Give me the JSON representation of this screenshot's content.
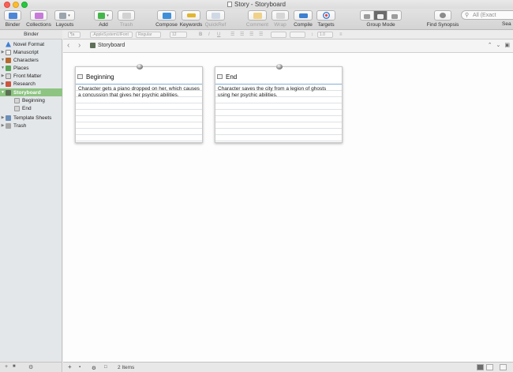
{
  "window": {
    "title": "Story - Storyboard"
  },
  "toolbar": {
    "binder": "Binder",
    "collections": "Collections",
    "layouts": "Layouts",
    "add": "Add",
    "trash": "Trash",
    "compose": "Compose",
    "keywords": "Keywords",
    "quickref": "QuickRef",
    "comment": "Comment",
    "wrap": "Wrap",
    "compile": "Compile",
    "targets": "Targets",
    "group_mode": "Group Mode",
    "find_synopsis": "Find Synopsis",
    "search_label": "Sea",
    "search_placeholder": "All (Exact"
  },
  "format_bar": {
    "style": "¶a",
    "font": ".AppleSystemUIFont",
    "weight": "Regular",
    "size": "12",
    "bold": "B",
    "italic": "I",
    "underline": "U",
    "line_spacing": "1.0"
  },
  "binder": {
    "header": "Binder",
    "items": [
      {
        "label": "Novel Format",
        "icon": "warning-icon",
        "depth": 0,
        "expander": ""
      },
      {
        "label": "Manuscript",
        "icon": "manuscript-icon",
        "depth": 0,
        "expander": "▶"
      },
      {
        "label": "Characters",
        "icon": "characters-icon",
        "depth": 0,
        "expander": "▼"
      },
      {
        "label": "Places",
        "icon": "places-icon",
        "depth": 0,
        "expander": "▼"
      },
      {
        "label": "Front Matter",
        "icon": "folder-icon",
        "depth": 0,
        "expander": "▶"
      },
      {
        "label": "Research",
        "icon": "research-icon",
        "depth": 0,
        "expander": "▶"
      },
      {
        "label": "Storyboard",
        "icon": "corkboard-icon",
        "depth": 0,
        "expander": "▼",
        "selected": true
      },
      {
        "label": "Beginning",
        "icon": "card-icon",
        "depth": 1,
        "expander": ""
      },
      {
        "label": "End",
        "icon": "card-icon",
        "depth": 1,
        "expander": ""
      },
      {
        "label": "Template Sheets",
        "icon": "template-icon",
        "depth": 0,
        "expander": "▶"
      },
      {
        "label": "Trash",
        "icon": "trash-icon",
        "depth": 0,
        "expander": "▶"
      }
    ],
    "footer": {
      "add": "+",
      "settings": "⚙"
    }
  },
  "editor": {
    "breadcrumb": "Storyboard",
    "back": "‹",
    "forward": "›",
    "cards": [
      {
        "title": "Beginning",
        "synopsis": "Character gets a piano dropped on her, which causes a concussion that gives her psychic abilities."
      },
      {
        "title": "End",
        "synopsis": "Character saves the city from a legion of ghosts using her psychic abilities."
      }
    ],
    "footer": {
      "add": "+",
      "item_count": "2 Items"
    }
  },
  "colors": {
    "selection": "#8dc482",
    "traffic_close": "#fc5f57",
    "traffic_min": "#fdbc2e",
    "traffic_max": "#27c840",
    "card_divider": "#7fb0d8"
  }
}
